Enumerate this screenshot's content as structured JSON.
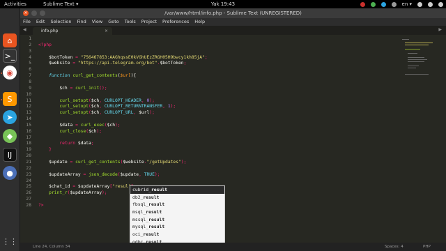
{
  "topbar": {
    "activities": "Activities",
    "app": "Sublime Text ▾",
    "clock": "Yak 19:43",
    "lang": "en ▾"
  },
  "window": {
    "title": "/var/www/html/info.php - Sublime Text (UNREGISTERED)"
  },
  "menu": [
    "File",
    "Edit",
    "Selection",
    "Find",
    "View",
    "Goto",
    "Tools",
    "Project",
    "Preferences",
    "Help"
  ],
  "tab": {
    "label": "info.php"
  },
  "code_lines": [
    {
      "n": "1",
      "t": ""
    },
    {
      "n": "2",
      "t": "<?php"
    },
    {
      "n": "3",
      "t": ""
    },
    {
      "n": "4",
      "t": "    $botToken = \"756467853:AAGhqssE0kVGhUEzZRGH05H9bwcy1kh85jA\";"
    },
    {
      "n": "5",
      "t": "    $website = \"https://api.telegram.org/bot\".$botToken;"
    },
    {
      "n": "6",
      "t": ""
    },
    {
      "n": "7",
      "t": "    function curl_get_contents($url){"
    },
    {
      "n": "8",
      "t": ""
    },
    {
      "n": "9",
      "t": "        $ch = curl_init();"
    },
    {
      "n": "10",
      "t": ""
    },
    {
      "n": "11",
      "t": "        curl_setopt($ch, CURLOPT_HEADER, 0);"
    },
    {
      "n": "12",
      "t": "        curl_setopt($ch, CURLOPT_RETURNTRANSFER, 1);"
    },
    {
      "n": "13",
      "t": "        curl_setopt($ch, CURLOPT_URL, $url);"
    },
    {
      "n": "14",
      "t": ""
    },
    {
      "n": "15",
      "t": "        $data = curl_exec($ch);"
    },
    {
      "n": "16",
      "t": "        curl_close($ch);"
    },
    {
      "n": "17",
      "t": ""
    },
    {
      "n": "18",
      "t": "        return $data;"
    },
    {
      "n": "19",
      "t": "    }"
    },
    {
      "n": "20",
      "t": ""
    },
    {
      "n": "21",
      "t": "    $update = curl_get_contents($website.\"/getUpdates\");"
    },
    {
      "n": "22",
      "t": ""
    },
    {
      "n": "23",
      "t": "    $updateArray = json_decode($update, TRUE);"
    },
    {
      "n": "24",
      "t": ""
    },
    {
      "n": "25",
      "t": "    $chat_id = $updateArray[\"resul\"]"
    },
    {
      "n": "26",
      "t": "    print_r($updateArray);"
    },
    {
      "n": "27",
      "t": ""
    },
    {
      "n": "28",
      "t": "?>"
    }
  ],
  "autocomplete": [
    {
      "pre": "cubrid_",
      "m": "result"
    },
    {
      "pre": "db2_",
      "m": "result"
    },
    {
      "pre": "fbsql_",
      "m": "result"
    },
    {
      "pre": "msql_",
      "m": "result"
    },
    {
      "pre": "mssql_",
      "m": "result"
    },
    {
      "pre": "mysql_",
      "m": "result"
    },
    {
      "pre": "oci_",
      "m": "result"
    },
    {
      "pre": "odbc_",
      "m": "result"
    }
  ],
  "status": {
    "position": "Line 24, Column 34",
    "spaces": "Spaces: 4",
    "syntax": "PHP"
  },
  "colors": {
    "accent": "#e95420",
    "editor_bg": "#272822",
    "keyword": "#f92672",
    "string": "#e6db74",
    "function": "#a6e22e"
  }
}
